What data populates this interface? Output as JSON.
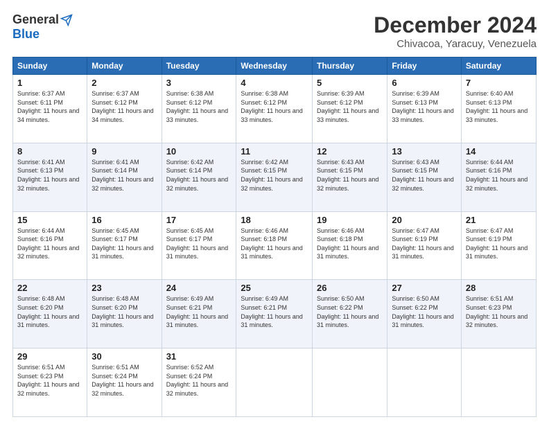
{
  "header": {
    "logo_general": "General",
    "logo_blue": "Blue",
    "month_title": "December 2024",
    "location": "Chivacoa, Yaracuy, Venezuela"
  },
  "weekdays": [
    "Sunday",
    "Monday",
    "Tuesday",
    "Wednesday",
    "Thursday",
    "Friday",
    "Saturday"
  ],
  "weeks": [
    [
      {
        "day": "1",
        "sunrise": "6:37 AM",
        "sunset": "6:11 PM",
        "daylight": "11 hours and 34 minutes."
      },
      {
        "day": "2",
        "sunrise": "6:37 AM",
        "sunset": "6:12 PM",
        "daylight": "11 hours and 34 minutes."
      },
      {
        "day": "3",
        "sunrise": "6:38 AM",
        "sunset": "6:12 PM",
        "daylight": "11 hours and 33 minutes."
      },
      {
        "day": "4",
        "sunrise": "6:38 AM",
        "sunset": "6:12 PM",
        "daylight": "11 hours and 33 minutes."
      },
      {
        "day": "5",
        "sunrise": "6:39 AM",
        "sunset": "6:12 PM",
        "daylight": "11 hours and 33 minutes."
      },
      {
        "day": "6",
        "sunrise": "6:39 AM",
        "sunset": "6:13 PM",
        "daylight": "11 hours and 33 minutes."
      },
      {
        "day": "7",
        "sunrise": "6:40 AM",
        "sunset": "6:13 PM",
        "daylight": "11 hours and 33 minutes."
      }
    ],
    [
      {
        "day": "8",
        "sunrise": "6:41 AM",
        "sunset": "6:13 PM",
        "daylight": "11 hours and 32 minutes."
      },
      {
        "day": "9",
        "sunrise": "6:41 AM",
        "sunset": "6:14 PM",
        "daylight": "11 hours and 32 minutes."
      },
      {
        "day": "10",
        "sunrise": "6:42 AM",
        "sunset": "6:14 PM",
        "daylight": "11 hours and 32 minutes."
      },
      {
        "day": "11",
        "sunrise": "6:42 AM",
        "sunset": "6:15 PM",
        "daylight": "11 hours and 32 minutes."
      },
      {
        "day": "12",
        "sunrise": "6:43 AM",
        "sunset": "6:15 PM",
        "daylight": "11 hours and 32 minutes."
      },
      {
        "day": "13",
        "sunrise": "6:43 AM",
        "sunset": "6:15 PM",
        "daylight": "11 hours and 32 minutes."
      },
      {
        "day": "14",
        "sunrise": "6:44 AM",
        "sunset": "6:16 PM",
        "daylight": "11 hours and 32 minutes."
      }
    ],
    [
      {
        "day": "15",
        "sunrise": "6:44 AM",
        "sunset": "6:16 PM",
        "daylight": "11 hours and 32 minutes."
      },
      {
        "day": "16",
        "sunrise": "6:45 AM",
        "sunset": "6:17 PM",
        "daylight": "11 hours and 31 minutes."
      },
      {
        "day": "17",
        "sunrise": "6:45 AM",
        "sunset": "6:17 PM",
        "daylight": "11 hours and 31 minutes."
      },
      {
        "day": "18",
        "sunrise": "6:46 AM",
        "sunset": "6:18 PM",
        "daylight": "11 hours and 31 minutes."
      },
      {
        "day": "19",
        "sunrise": "6:46 AM",
        "sunset": "6:18 PM",
        "daylight": "11 hours and 31 minutes."
      },
      {
        "day": "20",
        "sunrise": "6:47 AM",
        "sunset": "6:19 PM",
        "daylight": "11 hours and 31 minutes."
      },
      {
        "day": "21",
        "sunrise": "6:47 AM",
        "sunset": "6:19 PM",
        "daylight": "11 hours and 31 minutes."
      }
    ],
    [
      {
        "day": "22",
        "sunrise": "6:48 AM",
        "sunset": "6:20 PM",
        "daylight": "11 hours and 31 minutes."
      },
      {
        "day": "23",
        "sunrise": "6:48 AM",
        "sunset": "6:20 PM",
        "daylight": "11 hours and 31 minutes."
      },
      {
        "day": "24",
        "sunrise": "6:49 AM",
        "sunset": "6:21 PM",
        "daylight": "11 hours and 31 minutes."
      },
      {
        "day": "25",
        "sunrise": "6:49 AM",
        "sunset": "6:21 PM",
        "daylight": "11 hours and 31 minutes."
      },
      {
        "day": "26",
        "sunrise": "6:50 AM",
        "sunset": "6:22 PM",
        "daylight": "11 hours and 31 minutes."
      },
      {
        "day": "27",
        "sunrise": "6:50 AM",
        "sunset": "6:22 PM",
        "daylight": "11 hours and 31 minutes."
      },
      {
        "day": "28",
        "sunrise": "6:51 AM",
        "sunset": "6:23 PM",
        "daylight": "11 hours and 32 minutes."
      }
    ],
    [
      {
        "day": "29",
        "sunrise": "6:51 AM",
        "sunset": "6:23 PM",
        "daylight": "11 hours and 32 minutes."
      },
      {
        "day": "30",
        "sunrise": "6:51 AM",
        "sunset": "6:24 PM",
        "daylight": "11 hours and 32 minutes."
      },
      {
        "day": "31",
        "sunrise": "6:52 AM",
        "sunset": "6:24 PM",
        "daylight": "11 hours and 32 minutes."
      },
      null,
      null,
      null,
      null
    ]
  ]
}
